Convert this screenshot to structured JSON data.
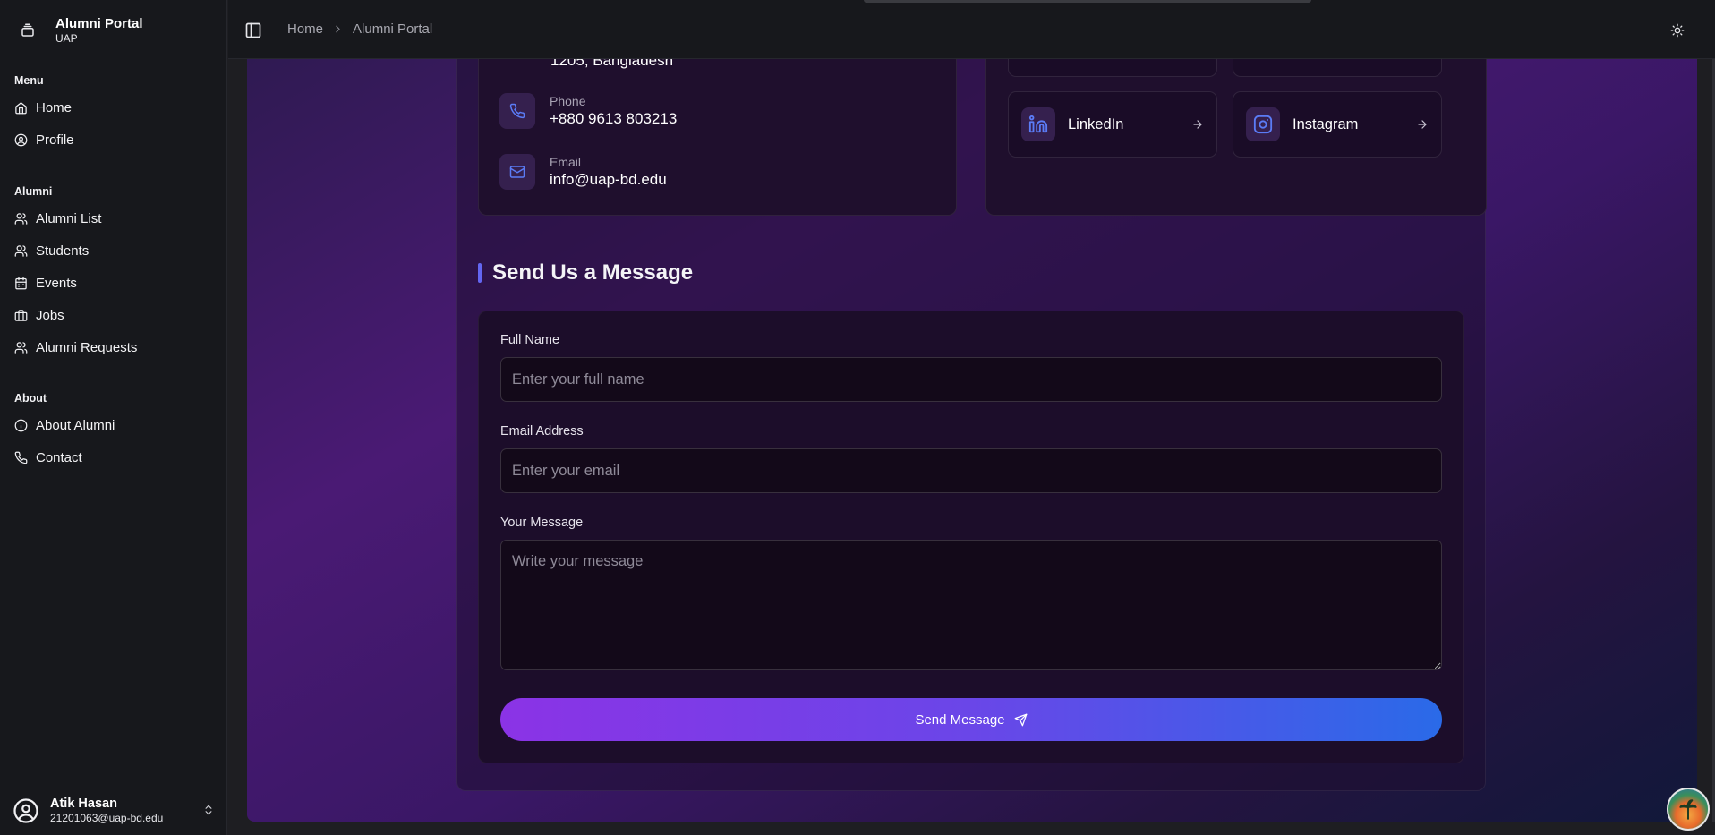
{
  "app": {
    "title": "Alumni Portal",
    "subtitle": "UAP"
  },
  "sidebar": {
    "groups": [
      {
        "label": "Menu",
        "items": [
          {
            "label": "Home",
            "icon": "home-icon"
          },
          {
            "label": "Profile",
            "icon": "user-circle-icon"
          }
        ]
      },
      {
        "label": "Alumni",
        "items": [
          {
            "label": "Alumni List",
            "icon": "users-icon"
          },
          {
            "label": "Students",
            "icon": "users-icon"
          },
          {
            "label": "Events",
            "icon": "calendar-icon"
          },
          {
            "label": "Jobs",
            "icon": "briefcase-icon"
          },
          {
            "label": "Alumni Requests",
            "icon": "users-icon"
          }
        ]
      },
      {
        "label": "About",
        "items": [
          {
            "label": "About Alumni",
            "icon": "info-icon"
          },
          {
            "label": "Contact",
            "icon": "phone-icon"
          }
        ]
      }
    ],
    "user": {
      "name": "Atik Hasan",
      "email": "21201063@uap-bd.edu"
    }
  },
  "breadcrumb": {
    "home": "Home",
    "current": "Alumni Portal"
  },
  "contact": {
    "address_tail": "1205, Bangladesh",
    "phone": {
      "label": "Phone",
      "value": "+880 9613 803213"
    },
    "email": {
      "label": "Email",
      "value": "info@uap-bd.edu"
    }
  },
  "social": [
    {
      "label": "LinkedIn",
      "icon": "linkedin-icon"
    },
    {
      "label": "Instagram",
      "icon": "instagram-icon"
    }
  ],
  "form": {
    "title": "Send Us a Message",
    "full_name": {
      "label": "Full Name",
      "placeholder": "Enter your full name"
    },
    "email": {
      "label": "Email Address",
      "placeholder": "Enter your email"
    },
    "message": {
      "label": "Your Message",
      "placeholder": "Write your message"
    },
    "submit_label": "Send Message"
  },
  "colors": {
    "accent": "#6366f1",
    "button_start": "#8b33e6",
    "button_end": "#2a6ae8",
    "icon_blue": "#5b7cf6"
  }
}
